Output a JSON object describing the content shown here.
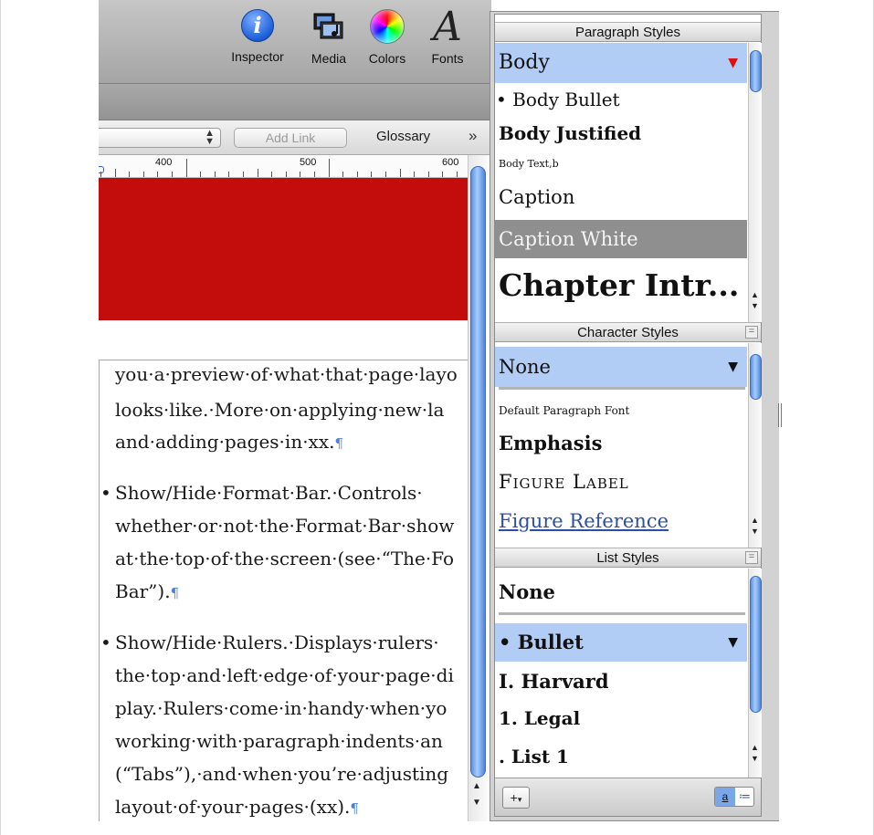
{
  "toolbar": {
    "inspector": {
      "label": "Inspector",
      "glyph": "i",
      "icon": "inspector-icon"
    },
    "media": {
      "label": "Media",
      "icon": "media-icon"
    },
    "colors": {
      "label": "Colors",
      "icon": "colors-icon"
    },
    "fonts": {
      "label": "Fonts",
      "glyph": "A",
      "icon": "fonts-icon"
    }
  },
  "format_bar": {
    "style_select_value": "",
    "add_link_label": "Add Link",
    "glossary_label": "Glossary",
    "more_glyph": "»"
  },
  "ruler": {
    "marks": [
      "400",
      "500",
      "600"
    ]
  },
  "document": {
    "colors": {
      "band": "#c30d0d",
      "pilcrow": "#4a80d8"
    },
    "lines": [
      "you·a·preview·of·what·that·page·layo",
      "looks·like.·More·on·applying·new·la",
      "and·adding·pages·in·xx.",
      "Show/Hide·Format·Bar.·Controls·",
      "whether·or·not·the·Format·Bar·show",
      "at·the·top·of·the·screen·(see·“The·Fo",
      "Bar”).",
      "Show/Hide·Rulers.·Displays·rulers·",
      "the·top·and·left·edge·of·your·page·di",
      "play.·Rulers·come·in·handy·when·yo",
      "working·with·paragraph·indents·an",
      "(“Tabs”),·and·when·you’re·adjusting",
      "layout·of·your·pages·(xx)."
    ],
    "bullet": "•",
    "pilcrow": "¶"
  },
  "paragraph_styles": {
    "title": "Paragraph Styles",
    "items": [
      {
        "label": "Body"
      },
      {
        "label": "• Body Bullet"
      },
      {
        "label": "Body Justified"
      },
      {
        "label": "Body Text,b"
      },
      {
        "label": "Caption"
      },
      {
        "label": "Caption White"
      },
      {
        "label": "Chapter Intr..."
      }
    ]
  },
  "character_styles": {
    "title": "Character Styles",
    "items": [
      {
        "label": "None"
      },
      {
        "label": "Default Paragraph Font"
      },
      {
        "label": "Emphasis"
      },
      {
        "label": "Figure Label"
      },
      {
        "label": "Figure Reference"
      }
    ]
  },
  "list_styles": {
    "title": "List Styles",
    "items": [
      {
        "label": "None"
      },
      {
        "label": "• Bullet"
      },
      {
        "label": "I. Harvard"
      },
      {
        "label": "1. Legal"
      },
      {
        "label": ". List 1"
      }
    ]
  },
  "drawer_footer": {
    "add_label": "+",
    "view_a_label": "a",
    "view_b_label": "≔"
  },
  "accent": {
    "selection": "#b2cdf5",
    "scroll_thumb": "#5d90df"
  }
}
